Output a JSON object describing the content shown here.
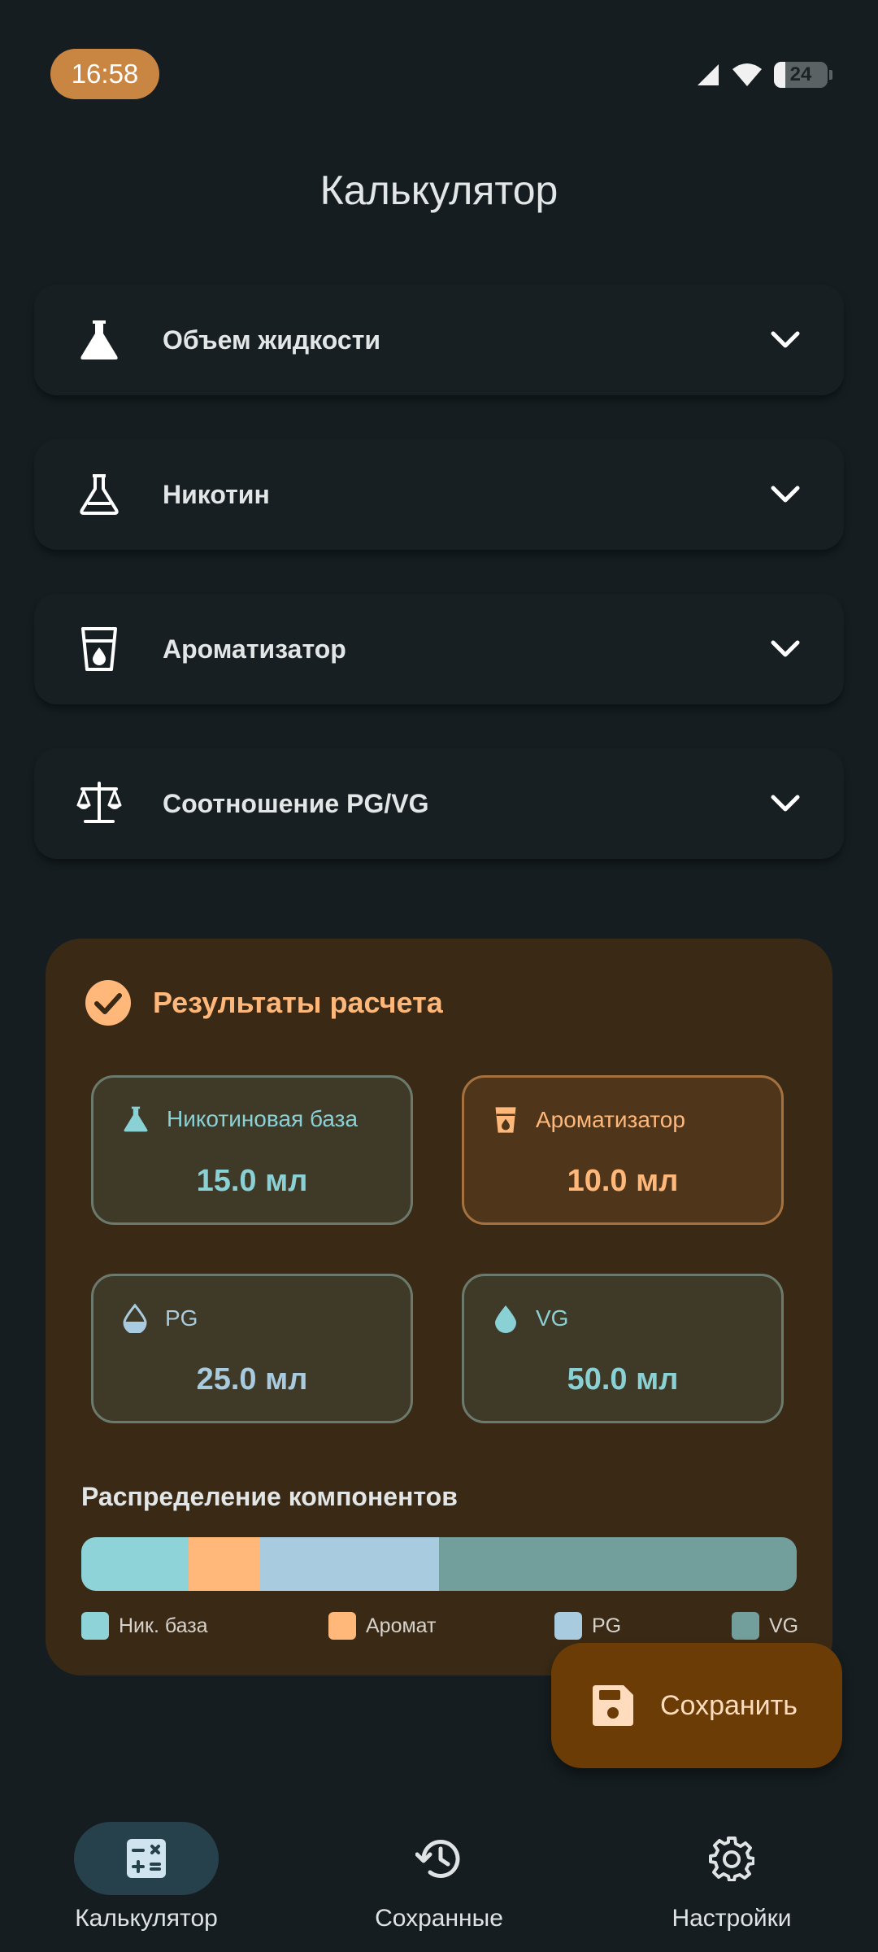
{
  "status_bar": {
    "time": "16:58",
    "battery": "24"
  },
  "app": {
    "title": "Калькулятор"
  },
  "sections": [
    {
      "label": "Объем жидкости",
      "icon": "flask-filled-icon"
    },
    {
      "label": "Никотин",
      "icon": "flask-outline-icon"
    },
    {
      "label": "Ароматизатор",
      "icon": "cup-drop-icon"
    },
    {
      "label": "Соотношение PG/VG",
      "icon": "scale-icon"
    }
  ],
  "results": {
    "title": "Результаты расчета",
    "cards": [
      {
        "label": "Никотиновая база",
        "value": "15.0 мл",
        "color": "#8ad1d6"
      },
      {
        "label": "Ароматизатор",
        "value": "10.0 мл",
        "color": "#ffb77a"
      },
      {
        "label": "PG",
        "value": "25.0 мл",
        "color": "#a8cbdf"
      },
      {
        "label": "VG",
        "value": "50.0 мл",
        "color": "#8ad1d6"
      }
    ],
    "distribution": {
      "title": "Распределение компонентов",
      "segments": [
        {
          "name": "Ник. база",
          "fraction": 0.15,
          "color": "#8dd3d8"
        },
        {
          "name": "Аромат",
          "fraction": 0.1,
          "color": "#ffb77a"
        },
        {
          "name": "PG",
          "fraction": 0.25,
          "color": "#a8cbdf"
        },
        {
          "name": "VG",
          "fraction": 0.5,
          "color": "#729e9b"
        }
      ]
    }
  },
  "fab": {
    "label": "Сохранить"
  },
  "nav": {
    "items": [
      {
        "label": "Калькулятор",
        "active": true
      },
      {
        "label": "Сохранные",
        "active": false
      },
      {
        "label": "Настройки",
        "active": false
      }
    ]
  },
  "colors": {
    "background": "#151d20",
    "accent": "#ffb77a",
    "results_bg": "#3a2a15",
    "fab_bg": "#6b3c05",
    "nav_active": "#26414c"
  }
}
